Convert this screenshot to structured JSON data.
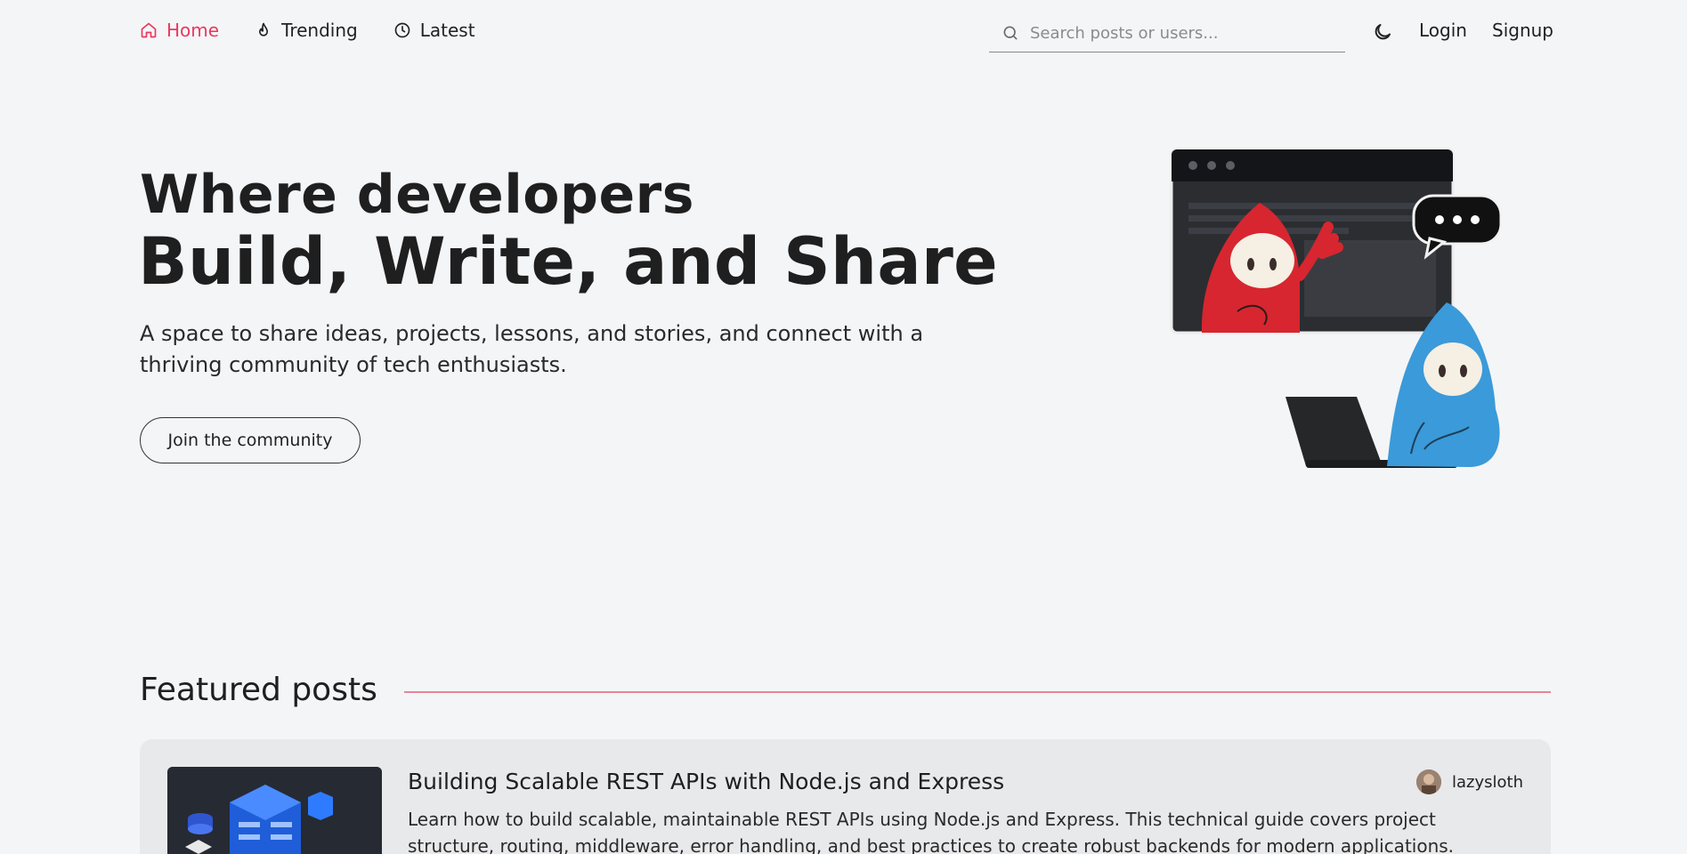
{
  "nav": {
    "items": [
      {
        "label": "Home",
        "icon": "home-icon",
        "active": true
      },
      {
        "label": "Trending",
        "icon": "flame-icon",
        "active": false
      },
      {
        "label": "Latest",
        "icon": "clock-icon",
        "active": false
      }
    ],
    "search_placeholder": "Search posts or users...",
    "theme_icon": "moon-icon",
    "login_label": "Login",
    "signup_label": "Signup"
  },
  "hero": {
    "subtitle": "Where developers",
    "title": "Build, Write, and Share",
    "description": "A space to share ideas, projects, lessons, and stories, and connect with a thriving community of tech enthusiasts.",
    "cta_label": "Join the community"
  },
  "featured": {
    "heading": "Featured posts",
    "posts": [
      {
        "title": "Building Scalable REST APIs with Node.js and Express",
        "description": "Learn how to build scalable, maintainable REST APIs using Node.js and Express. This technical guide covers project structure, routing, middleware, error handling, and best practices to create robust backends for modern applications.",
        "author": "lazysloth"
      }
    ]
  },
  "colors": {
    "accent": "#e8395e",
    "background": "#f4f5f7",
    "card": "#e8e9eb"
  }
}
